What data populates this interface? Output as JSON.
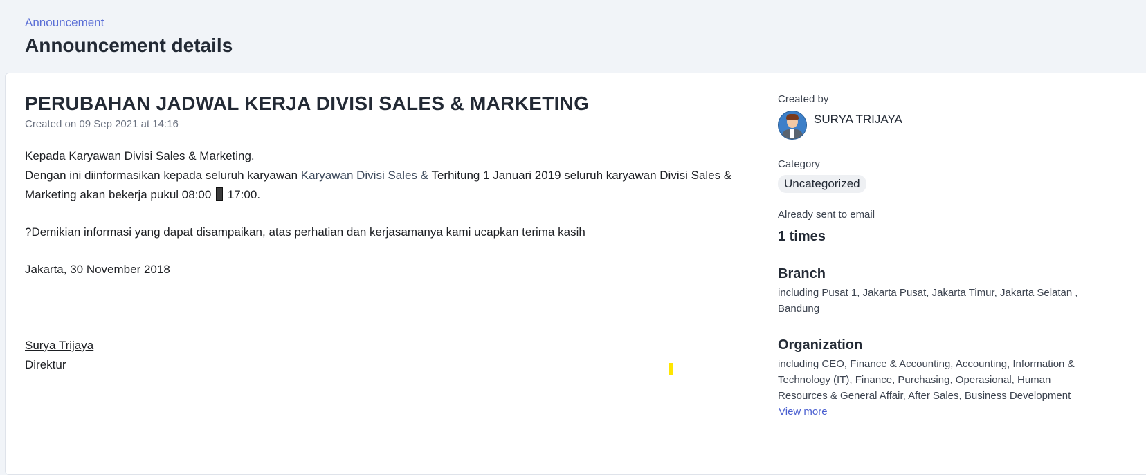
{
  "header": {
    "breadcrumb": "Announcement",
    "title": "Announcement details"
  },
  "announcement": {
    "title": "PERUBAHAN JADWAL KERJA DIVISI SALES & MARKETING",
    "created_on": "Created on 09 Sep 2021 at 14:16",
    "greeting": "Kepada Karyawan Divisi Sales & Marketing.",
    "line2_part1": "Dengan ini diinformasikan kepada seluruh karyawan ",
    "line2_link": "Karyawan Divisi Sales & ",
    "line2_part2": "Terhitung 1 Januari 2019 seluruh karyawan Divisi Sales & Marketing akan bekerja pukul 08:00 ",
    "line2_part3": " 17:00.",
    "closing": "?Demikian informasi yang dapat disampaikan, atas perhatian dan kerjasamanya kami ucapkan terima kasih",
    "place_date": "Jakarta, 30 November 2018",
    "signer_name": "Surya Trijaya",
    "signer_role": "Direktur"
  },
  "sidebar": {
    "created_by_label": "Created by",
    "creator_name": "SURYA TRIJAYA",
    "category_label": "Category",
    "category_value": "Uncategorized",
    "email_label": "Already sent to email",
    "email_count": "1 times",
    "branch_title": "Branch",
    "branch_text": "including Pusat 1, Jakarta Pusat, Jakarta Timur, Jakarta Selatan , Bandung",
    "organization_title": "Organization",
    "organization_text": "including CEO, Finance & Accounting, Accounting, Information & Technology (IT), Finance, Purchasing, Operasional, Human Resources & General Affair, After Sales, Business Development",
    "view_more": "View more"
  },
  "colors": {
    "accent": "#5b6fd6",
    "page_bg": "#f1f4f8",
    "cursor_highlight": "#ffe600"
  }
}
